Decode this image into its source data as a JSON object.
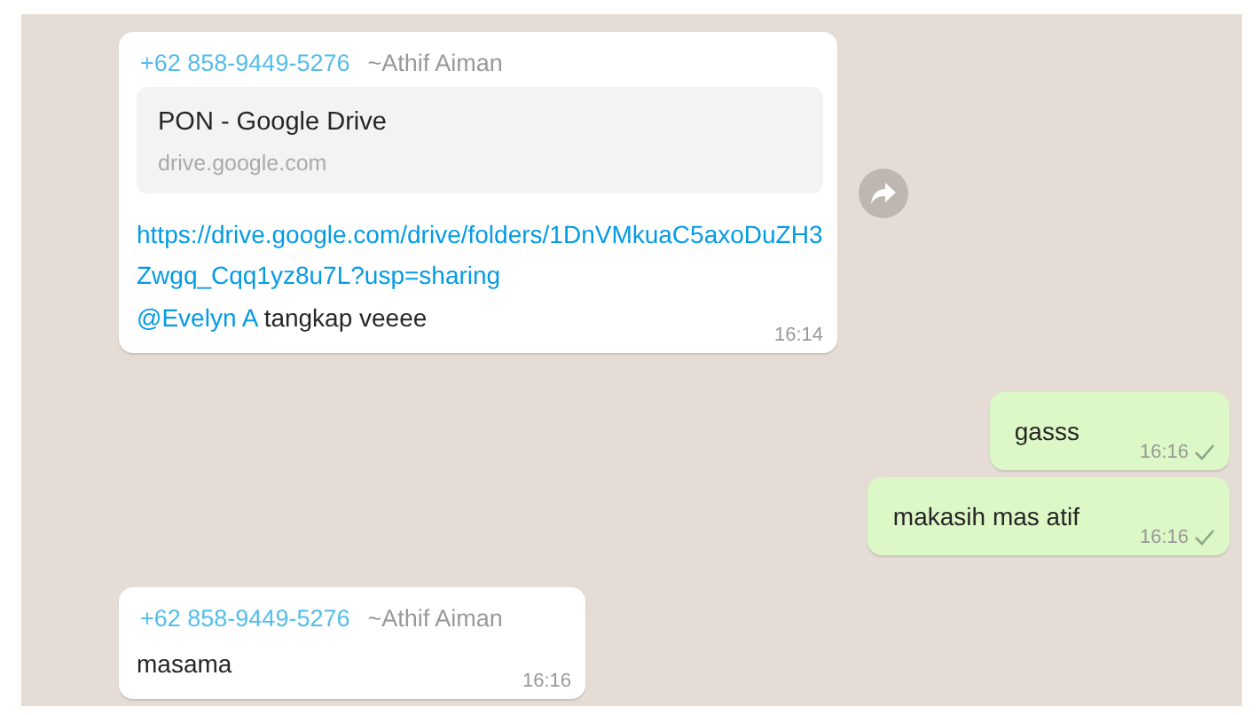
{
  "messages": [
    {
      "kind": "incoming",
      "sender_phone": "+62 858-9449-5276",
      "sender_name": "~Athif Aiman",
      "preview": {
        "title": "PON - Google Drive",
        "domain": "drive.google.com"
      },
      "link": "https://drive.google.com/drive/folders/1DnVMkuaC5axoDuZH3Zwgq_Cqq1yz8u7L?usp=sharing",
      "mention": "@Evelyn A",
      "text": "tangkap veeee",
      "time": "16:14",
      "forward": true
    },
    {
      "kind": "outgoing",
      "text": "gasss",
      "time": "16:16",
      "delivered": false
    },
    {
      "kind": "outgoing",
      "text": "makasih mas atif",
      "time": "16:16",
      "delivered": false
    },
    {
      "kind": "incoming",
      "sender_phone": "+62 858-9449-5276",
      "sender_name": "~Athif Aiman",
      "text": "masama",
      "time": "16:16"
    }
  ]
}
